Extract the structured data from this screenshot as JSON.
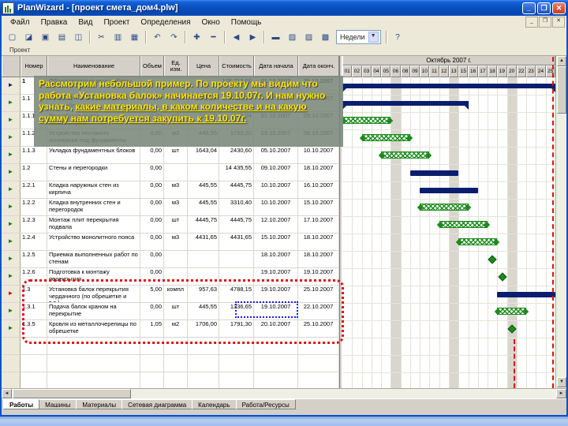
{
  "window": {
    "title": "PlanWizard - [проект смета_дом4.plw]"
  },
  "titlebar": {
    "minimize": "_",
    "maximize": "❐",
    "close": "✕"
  },
  "menu": {
    "items": [
      "Файл",
      "Правка",
      "Вид",
      "Проект",
      "Определения",
      "Окно",
      "Помощь"
    ]
  },
  "toolbar": {
    "buttons": [
      {
        "name": "new-file",
        "glyph": "▢"
      },
      {
        "name": "open-file",
        "glyph": "◪"
      },
      {
        "name": "save-file",
        "glyph": "▣"
      },
      {
        "name": "print",
        "glyph": "▤"
      },
      {
        "name": "print-preview",
        "glyph": "◫"
      },
      {
        "name": "cut",
        "glyph": "✂"
      },
      {
        "name": "copy",
        "glyph": "▥"
      },
      {
        "name": "paste",
        "glyph": "▦"
      },
      {
        "name": "undo",
        "glyph": "↶"
      },
      {
        "name": "redo",
        "glyph": "↷"
      },
      {
        "name": "insert-row",
        "glyph": "✚"
      },
      {
        "name": "delete-row",
        "glyph": "━"
      },
      {
        "name": "outdent",
        "glyph": "◀"
      },
      {
        "name": "indent",
        "glyph": "▶"
      },
      {
        "name": "gantt-view",
        "glyph": "▬"
      },
      {
        "name": "network-view",
        "glyph": "▧"
      },
      {
        "name": "table-view",
        "glyph": "▨"
      },
      {
        "name": "calendar-view",
        "glyph": "▩"
      },
      {
        "name": "help",
        "glyph": "?"
      }
    ],
    "scale_combo": {
      "value": "Недели",
      "arrow": "▼"
    }
  },
  "panel": {
    "caption": "Проект"
  },
  "table": {
    "headers": [
      "Номер",
      "Наименование",
      "Объем",
      "Ед. изм.",
      "Цена",
      "Стоимость",
      "Дата начала",
      "Дата оконч."
    ],
    "rows": [
      {
        "num": "1",
        "name": "Общестроительные работы",
        "vol": "",
        "unit": "",
        "price": "",
        "cost": "128 713,00",
        "start": "01.10.2007",
        "end": "25.10.2007",
        "marker": "navy",
        "bold": true
      },
      {
        "num": "1.1",
        "name": "Фундаменты монолитные железобетонные",
        "vol": "0,00",
        "unit": "м3",
        "price": "1643,04",
        "cost": "4435,16",
        "start": "01.10.2007",
        "end": "15.10.2007",
        "marker": "green",
        "bold": false
      },
      {
        "num": "1.1.1",
        "name": "Разработка грунта экскаватором",
        "vol": "0,00",
        "unit": "м3",
        "price": "121,50",
        "cost": "1643,04",
        "start": "01.10.2007",
        "end": "05.10.2007",
        "marker": "green",
        "bold": false
      },
      {
        "num": "1.1.2",
        "name": "Устройство песчаного основания под фундаменты",
        "vol": "0,00",
        "unit": "м3",
        "price": "445,55",
        "cost": "1750,20",
        "start": "03.10.2007",
        "end": "08.10.2007",
        "marker": "green",
        "bold": false
      },
      {
        "num": "1.1.3",
        "name": "Укладка фундаментных блоков",
        "vol": "0,00",
        "unit": "шт",
        "price": "1643,04",
        "cost": "2430,60",
        "start": "05.10.2007",
        "end": "10.10.2007",
        "marker": "green",
        "bold": false
      },
      {
        "num": "1.2",
        "name": "Стены и перегородки",
        "vol": "0,00",
        "unit": "",
        "price": "",
        "cost": "14 435,55",
        "start": "09.10.2007",
        "end": "18.10.2007",
        "marker": "green",
        "bold": false
      },
      {
        "num": "1.2.1",
        "name": "Кладка наружных стен из кирпича",
        "vol": "0,00",
        "unit": "м3",
        "price": "445,55",
        "cost": "4445,75",
        "start": "10.10.2007",
        "end": "16.10.2007",
        "marker": "green",
        "bold": false
      },
      {
        "num": "1.2.2",
        "name": "Кладка внутренних стен и перегородок",
        "vol": "0,00",
        "unit": "м3",
        "price": "445,55",
        "cost": "3310,40",
        "start": "10.10.2007",
        "end": "15.10.2007",
        "marker": "green",
        "bold": false
      },
      {
        "num": "1.2.3",
        "name": "Монтаж плит перекрытия подвала",
        "vol": "0,00",
        "unit": "шт",
        "price": "4445,75",
        "cost": "4445,75",
        "start": "12.10.2007",
        "end": "17.10.2007",
        "marker": "green",
        "bold": false
      },
      {
        "num": "1.2.4",
        "name": "Устройство монолитного пояса",
        "vol": "0,00",
        "unit": "м3",
        "price": "4431,65",
        "cost": "4431,65",
        "start": "15.10.2007",
        "end": "18.10.2007",
        "marker": "green",
        "bold": false
      },
      {
        "num": "1.2.5",
        "name": "Приемка выполненных работ по стенам",
        "vol": "0,00",
        "unit": "",
        "price": "",
        "cost": "",
        "start": "18.10.2007",
        "end": "18.10.2007",
        "marker": "green",
        "bold": false
      },
      {
        "num": "1.2.6",
        "name": "Подготовка к монтажу перекрытия",
        "vol": "0,00",
        "unit": "",
        "price": "",
        "cost": "",
        "start": "19.10.2007",
        "end": "19.10.2007",
        "marker": "green",
        "bold": false
      },
      {
        "num": "1.3",
        "name": "Установка балок перекрытия чердачного (по обрешетке и т.д.)",
        "vol": "5,00",
        "unit": "компл",
        "price": "957,63",
        "cost": "4788,15",
        "start": "19.10.2007",
        "end": "25.10.2007",
        "marker": "red",
        "bold": false
      },
      {
        "num": "1.3.1",
        "name": "Подача балок краном на перекрытие",
        "vol": "0,00",
        "unit": "шт",
        "price": "445,55",
        "cost": "1336,65",
        "start": "19.10.2007",
        "end": "22.10.2007",
        "marker": "green",
        "bold": false
      },
      {
        "num": "1.3.5",
        "name": "Кровля из металлочерепицы по обрешетке",
        "vol": "1,05",
        "unit": "м2",
        "price": "1706,00",
        "cost": "1791,30",
        "start": "20.10.2007",
        "end": "25.10.2007",
        "marker": "green",
        "bold": false
      }
    ],
    "empty_rows": 3
  },
  "gantt": {
    "month_label": "Октябрь 2007 г.",
    "days": [
      "01",
      "02",
      "03",
      "04",
      "05",
      "06",
      "08",
      "09",
      "10",
      "11",
      "12",
      "13",
      "15",
      "16",
      "17",
      "18",
      "19",
      "20",
      "22",
      "23",
      "24",
      "25"
    ],
    "weekend_days": [
      "06",
      "13",
      "20"
    ],
    "bars": [
      {
        "row": 0,
        "type": "summary",
        "from": "01",
        "to": "25"
      },
      {
        "row": 1,
        "type": "summary",
        "from": "01",
        "to": "15"
      },
      {
        "row": 2,
        "type": "hatch",
        "from": "01",
        "to": "05"
      },
      {
        "row": 3,
        "type": "hatch",
        "from": "03",
        "to": "08"
      },
      {
        "row": 4,
        "type": "hatch",
        "from": "05",
        "to": "10"
      },
      {
        "row": 5,
        "type": "task",
        "from": "09",
        "to": "13"
      },
      {
        "row": 6,
        "type": "task",
        "from": "10",
        "to": "16"
      },
      {
        "row": 7,
        "type": "hatch",
        "from": "10",
        "to": "15"
      },
      {
        "row": 8,
        "type": "hatch",
        "from": "12",
        "to": "17"
      },
      {
        "row": 9,
        "type": "hatch",
        "from": "15",
        "to": "18"
      },
      {
        "row": 10,
        "type": "milestone",
        "from": "18",
        "to": "18"
      },
      {
        "row": 11,
        "type": "milestone",
        "from": "19",
        "to": "19"
      },
      {
        "row": 12,
        "type": "task",
        "from": "19",
        "to": "25"
      },
      {
        "row": 13,
        "type": "hatch",
        "from": "19",
        "to": "22"
      },
      {
        "row": 14,
        "type": "milestone",
        "from": "20",
        "to": "20"
      }
    ]
  },
  "overlay": {
    "part1": "Рассмотрим небольшой пример. По проекту мы видим что работа «Установка балок» начинается 19.10.07г. И нам нужно узнать, ",
    "part2": "какие материалы, в каком количестве и на какую сумму нам потребуется закупить к 19.10.07г."
  },
  "tabs": {
    "items": [
      "Работы",
      "Машины",
      "Материалы",
      "Сетевая диаграмма",
      "Календарь",
      "Работа/Ресурсы"
    ],
    "active": "Работы"
  },
  "scroll": {
    "up": "▲",
    "down": "▼",
    "left": "◄",
    "right": "►"
  },
  "colors": {
    "bar_navy": "#0b1e6e",
    "hatch_green": "#1e8a1e",
    "highlight_red": "#e01010",
    "highlight_blue": "#1a1aff",
    "overlay_text": "#ffe400"
  }
}
